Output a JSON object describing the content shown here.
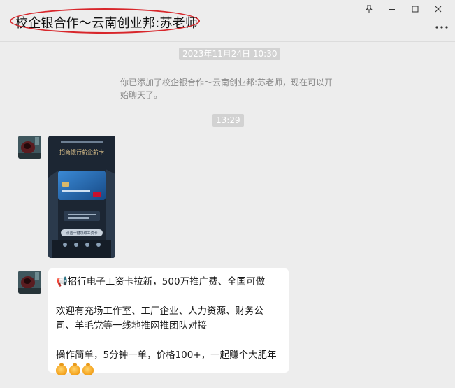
{
  "window": {
    "title": "校企银合作～云南创业邦:苏老师",
    "controls": [
      "pin-icon",
      "minimize-icon",
      "maximize-icon",
      "close-icon"
    ],
    "more_icon": "more-dots-icon",
    "highlight_color": "#d8262b"
  },
  "chat": {
    "timestamp_1": "2023年11月24日 10:30",
    "system_message": "你已添加了校企银合作～云南创业邦:苏老师，现在可以开始聊天了。",
    "timestamp_2": "13:29",
    "image_message": {
      "banner": "招商银行薪企薪卡",
      "button": "点击一键领取工资卡"
    },
    "text_message": {
      "line1": "📢招行电子工资卡拉新，500万推广费、全国可做",
      "line2": "欢迎有充场工作室、工厂企业、人力资源、财务公司、羊毛党等一线地推网推团队对接",
      "line3": "操作简单，5分钟一单，价格100+，一起赚个大肥年",
      "emoji_icons": [
        "money-bag-icon",
        "money-bag-icon",
        "money-bag-icon"
      ]
    }
  },
  "colors": {
    "background": "#ededed",
    "bubble": "#ffffff",
    "timestamp_bg": "#d2d2d2",
    "system_text": "#8a8a8a"
  }
}
